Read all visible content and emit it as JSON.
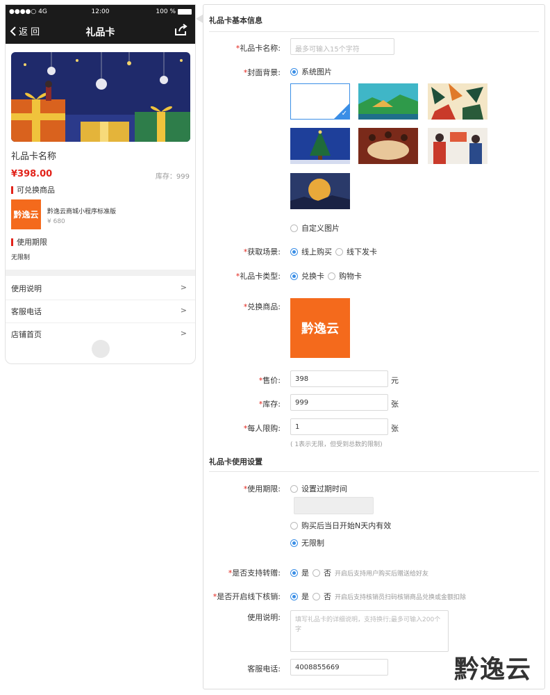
{
  "phone": {
    "status": {
      "signal": "●●●●○ 4G",
      "time": "12:00",
      "battery": "100 %"
    },
    "nav": {
      "back_label": "返 回",
      "title": "礼品卡"
    },
    "card_name": "礼品卡名称",
    "price": "¥398.00",
    "stock": "库存：999",
    "exchange_title": "可兑换商品",
    "goods": {
      "logo_text": "黔逸云",
      "name": "黔逸云商城小程序标准版",
      "price": "¥ 680"
    },
    "period_title": "使用期限",
    "period_value": "无限制",
    "rows": [
      {
        "label": "使用说明"
      },
      {
        "label": "客服电话"
      },
      {
        "label": "店铺首页"
      }
    ]
  },
  "form": {
    "section1_title": "礼品卡基本信息",
    "name": {
      "label": "礼品卡名称:",
      "placeholder": "最多可输入15个字符"
    },
    "cover": {
      "label": "封面背景:",
      "option_system": "系统图片",
      "option_custom": "自定义图片"
    },
    "scene": {
      "label": "获取场景:",
      "online": "线上购买",
      "offline": "线下发卡"
    },
    "type": {
      "label": "礼品卡类型:",
      "exchange": "兑换卡",
      "shopping": "购物卡"
    },
    "goods": {
      "label": "兑换商品:",
      "logo_text": "黔逸云"
    },
    "price": {
      "label": "售价:",
      "value": "398",
      "unit": "元"
    },
    "stock": {
      "label": "库存:",
      "value": "999",
      "unit": "张"
    },
    "limit": {
      "label": "每人限购:",
      "value": "1",
      "unit": "张",
      "hint": "( 1表示无限，但受到总数的限制)"
    },
    "section2_title": "礼品卡使用设置",
    "period": {
      "label": "使用期限:",
      "option_expire": "设置过期时间",
      "option_days": "购买后当日开始N天内有效",
      "option_unlimited": "无限制"
    },
    "transfer": {
      "label": "是否支持转赠:",
      "yes": "是",
      "no": "否",
      "hint": "开启后支持用户购买后赠送给好友"
    },
    "offline_verify": {
      "label": "是否开启线下核销:",
      "yes": "是",
      "no": "否",
      "hint": "开启后支持核销员扫码核销商品兑换或金额扣除"
    },
    "description": {
      "label": "使用说明:",
      "placeholder": "填写礼品卡的详细说明，支持换行;最多可输入200个字"
    },
    "service_phone": {
      "label": "客服电话:",
      "value": "4008855669"
    }
  },
  "watermark": "黔逸云",
  "colors": {
    "accent": "#3a8ee6",
    "price_red": "#e2231a",
    "brand_orange": "#f46a1c",
    "nav_black": "#1b1b1b"
  }
}
